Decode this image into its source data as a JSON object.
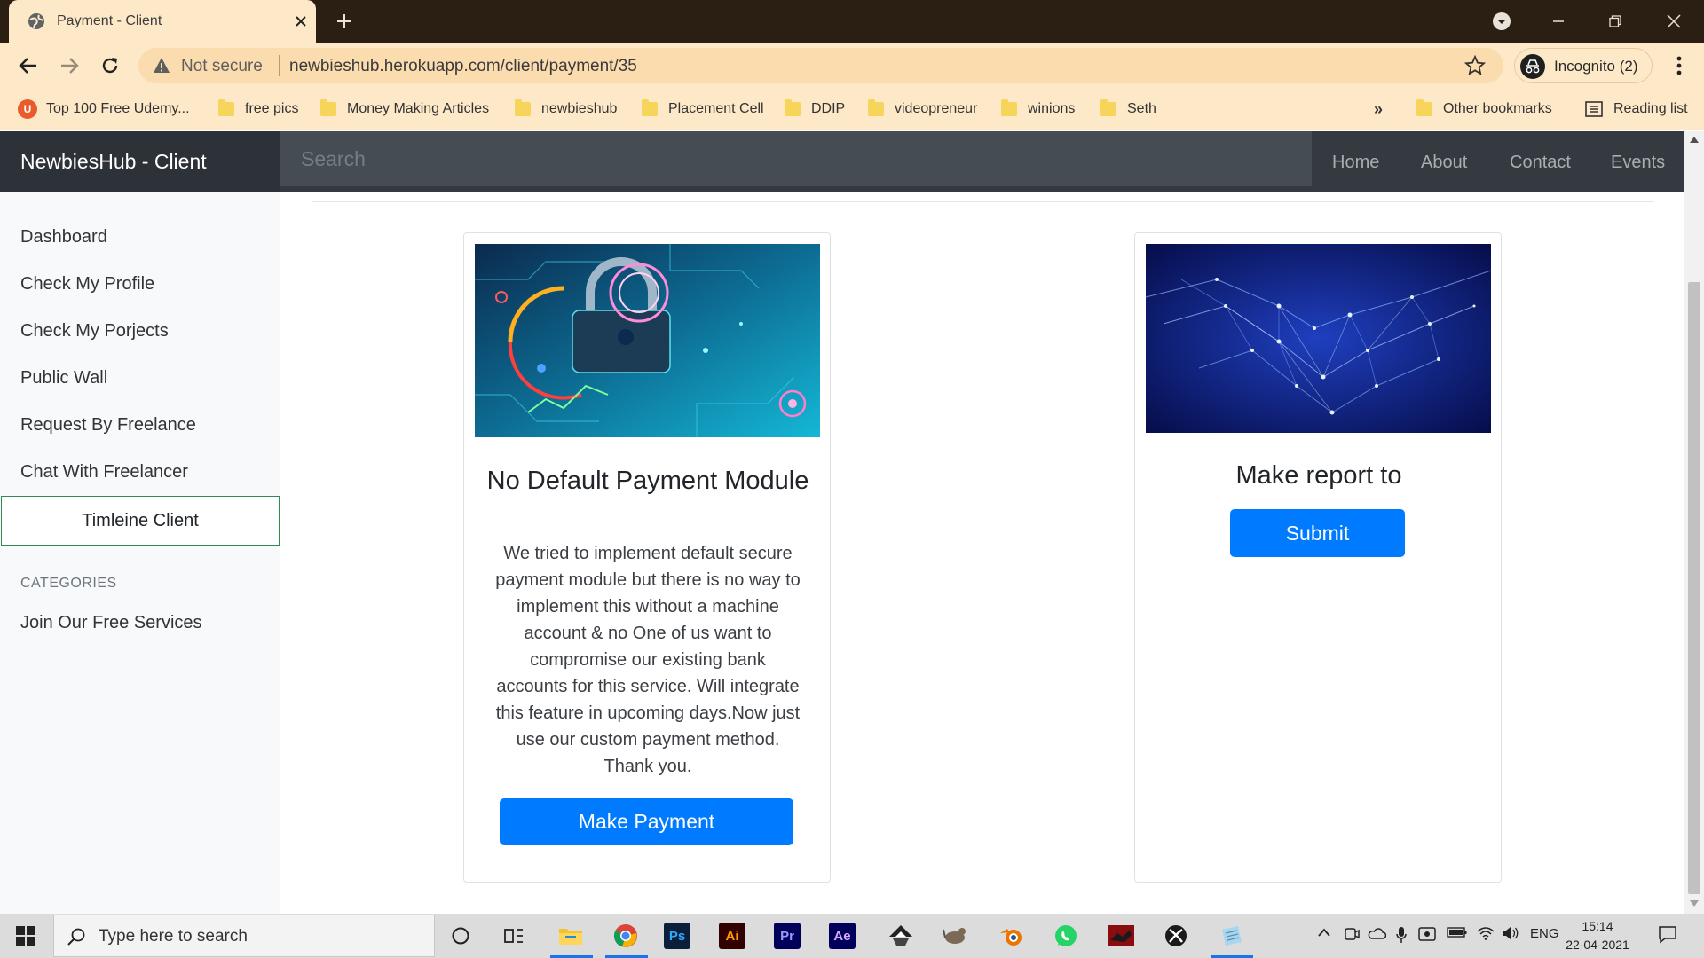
{
  "browser": {
    "tab_title": "Payment - Client",
    "omnibox_security": "Not secure",
    "url": "newbieshub.herokuapp.com/client/payment/35",
    "incognito_label": "Incognito (2)",
    "bookmarks": [
      {
        "label": "Top 100 Free Udemy...",
        "icon": "udemy-icon"
      },
      {
        "label": "free pics",
        "icon": "folder-icon"
      },
      {
        "label": "Money Making Articles",
        "icon": "folder-icon"
      },
      {
        "label": "newbieshub",
        "icon": "folder-icon"
      },
      {
        "label": "Placement Cell",
        "icon": "folder-icon"
      },
      {
        "label": "DDIP",
        "icon": "folder-icon"
      },
      {
        "label": "videopreneur",
        "icon": "folder-icon"
      },
      {
        "label": "winions",
        "icon": "folder-icon"
      },
      {
        "label": "Seth",
        "icon": "folder-icon"
      }
    ],
    "overflow_label": "»",
    "other_bookmarks": "Other bookmarks",
    "reading_list": "Reading list"
  },
  "navbar": {
    "brand": "NewbiesHub - Client",
    "search_placeholder": "Search",
    "links": [
      "Home",
      "About",
      "Contact",
      "Events"
    ]
  },
  "sidebar": {
    "items": [
      "Dashboard",
      "Check My Profile",
      "Check My Porjects",
      "Public Wall",
      "Request By Freelance",
      "Chat With Freelancer"
    ],
    "active_item": "Timleine Client",
    "category_heading": "CATEGORIES",
    "category_items": [
      "Join Our Free Services"
    ]
  },
  "cards": {
    "payment": {
      "title": "No Default Payment Module",
      "text": "We tried to implement default secure payment module but there is no way to implement this without a machine account & no One of us want to compromise our existing bank accounts for this service. Will integrate this feature in upcoming days.Now just use our custom payment method. Thank you.",
      "button": "Make Payment"
    },
    "report": {
      "title": "Make report to",
      "button": "Submit"
    }
  },
  "taskbar": {
    "search_placeholder": "Type here to search",
    "apps": [
      "cortana-icon",
      "task-view-icon",
      "file-explorer-icon",
      "chrome-icon",
      "photoshop-icon",
      "illustrator-icon",
      "premiere-icon",
      "after-effects-icon",
      "inkscape-icon",
      "gimp-icon",
      "blender-icon",
      "whatsapp-icon",
      "app-icon",
      "xbox-icon",
      "notepad-icon"
    ],
    "app_labels": {
      "ps": "Ps",
      "ai": "Ai",
      "pr": "Pr",
      "ae": "Ae"
    },
    "language": "ENG",
    "time": "15:14",
    "date": "22-04-2021"
  },
  "colors": {
    "chrome_frame": "#2b1f14",
    "chrome_toolbar": "#fde8c8",
    "navbar": "#343a40",
    "primary": "#007bff",
    "active_border": "#2e8b57"
  }
}
